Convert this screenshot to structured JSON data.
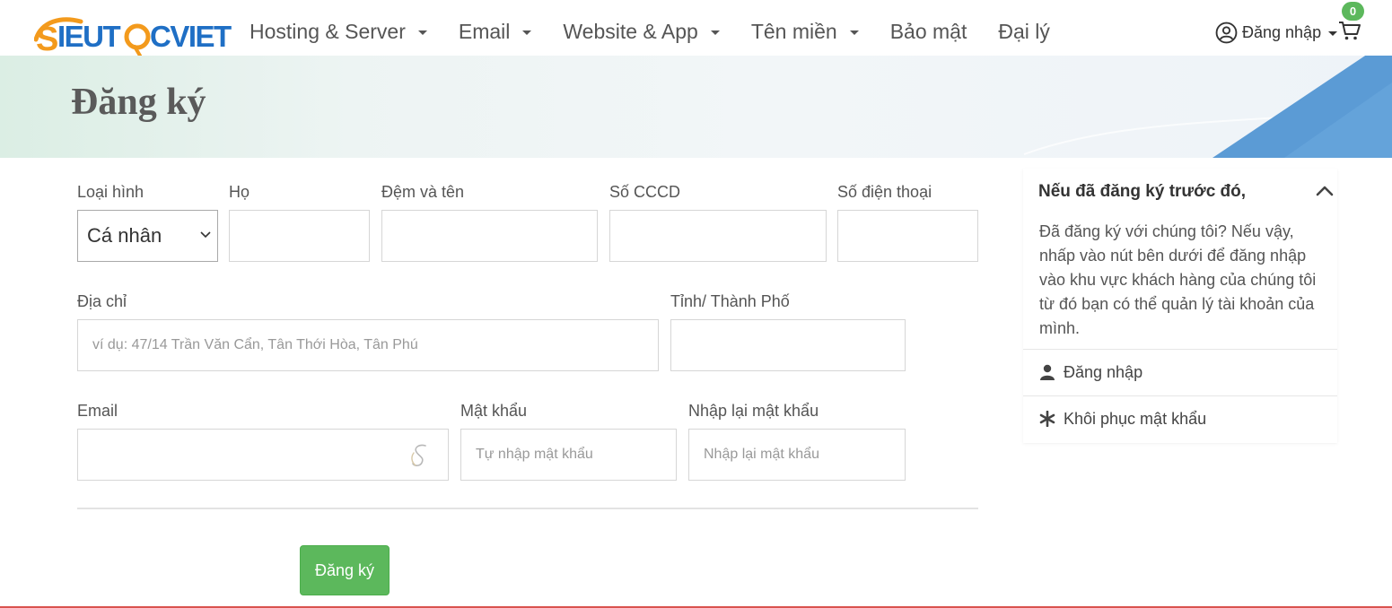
{
  "header": {
    "brand": "SIEUTOCVIET",
    "nav": [
      {
        "label": "Hosting & Server",
        "has_dropdown": true
      },
      {
        "label": "Email",
        "has_dropdown": true
      },
      {
        "label": "Website & App",
        "has_dropdown": true
      },
      {
        "label": "Tên miền",
        "has_dropdown": true
      },
      {
        "label": "Bảo mật",
        "has_dropdown": false
      },
      {
        "label": "Đại lý",
        "has_dropdown": false
      }
    ],
    "account_label": "Đăng nhập",
    "cart_count": "0"
  },
  "page_title": "Đăng ký",
  "form": {
    "type_label": "Loại hình",
    "type_value": "Cá nhân",
    "last_name_label": "Họ",
    "first_name_label": "Đệm và tên",
    "id_label": "Số CCCD",
    "phone_label": "Số điện thoại",
    "address_label": "Địa chỉ",
    "address_placeholder": "ví dụ: 47/14 Trần Văn Cẩn, Tân Thới Hòa, Tân Phú",
    "city_label": "Tỉnh/ Thành Phố",
    "email_label": "Email",
    "password_label": "Mật khẩu",
    "password_placeholder": "Tự nhập mật khẩu",
    "confirm_label": "Nhập lại mật khẩu",
    "confirm_placeholder": "Nhập lại mật khẩu",
    "submit_label": "Đăng ký"
  },
  "sidebar": {
    "title": "Nếu đã đăng ký trước đó,",
    "body": "Đã đăng ký với chúng tôi? Nếu vậy, nhấp vào nút bên dưới để đăng nhập vào khu vực khách hàng của chúng tôi từ đó bạn có thể quản lý tài khoản của mình.",
    "login_label": "Đăng nhập",
    "recover_label": "Khôi phục mật khẩu"
  },
  "colors": {
    "brand_orange": "#f39a1c",
    "brand_blue": "#1f6fc5",
    "button_green": "#5cb85c",
    "badge_green": "#5cb85c",
    "accent_blue": "#5b9bd5"
  },
  "icons": [
    "user-circle-icon",
    "chevron-down-icon",
    "cart-icon",
    "chevron-up-icon",
    "user-icon",
    "asterisk-icon"
  ]
}
